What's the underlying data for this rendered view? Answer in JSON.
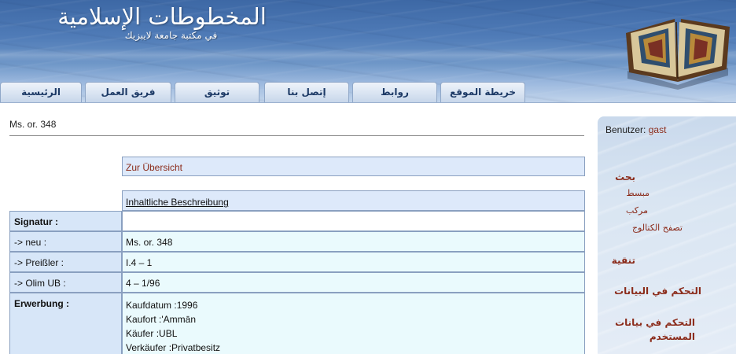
{
  "header": {
    "title": "المخطوطات الإسلامية",
    "subtitle": "في مكتبة جامعة لايبزيك"
  },
  "nav": {
    "tabs": [
      {
        "label": "خريطة الموقع"
      },
      {
        "label": "روابط"
      },
      {
        "label": "إتصل بنا"
      },
      {
        "label": "توثيق"
      },
      {
        "label": "فريق العمل"
      },
      {
        "label": "الرئيسية"
      }
    ]
  },
  "main": {
    "page_title": "Ms. or. 348",
    "overview_link": "Zur Übersicht",
    "description_link": "Inhaltliche Beschreibung",
    "rows": [
      {
        "label": "Signatur :",
        "value": ""
      },
      {
        "label": "-> neu :",
        "value": "Ms. or. 348"
      },
      {
        "label": "-> Preißler :",
        "value": "I.4 – 1"
      },
      {
        "label": "-> Olim UB :",
        "value": "4 – 1/96"
      },
      {
        "label": "Erwerbung :",
        "lines": [
          "Kaufdatum :1996",
          "Kaufort :'Ammān",
          "Käufer :UBL",
          "Verkäufer :Privatbesitz"
        ]
      }
    ]
  },
  "sidebar": {
    "user_label": "Benutzer:",
    "user_name": "gast",
    "search_heading": "بحث",
    "search_items": [
      "مبسط",
      "مركب",
      "تصفح الكتالوج"
    ],
    "menu": [
      "تنقية",
      "التحكم في البيانات"
    ],
    "menu_user_data": [
      "التحكم في بيانات",
      "المستخدم"
    ]
  },
  "colors": {
    "accent_link": "#8b2b1a",
    "header_blue": "#4f7bb7",
    "label_cell": "#d7e6f8",
    "value_cell": "#eafafd"
  },
  "icons": {
    "header_image": "open-manuscript-book"
  }
}
